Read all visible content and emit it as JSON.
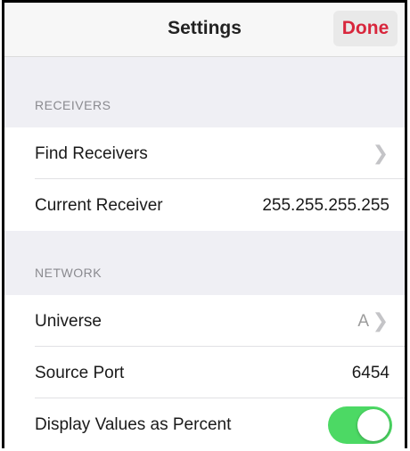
{
  "navbar": {
    "title": "Settings",
    "done_label": "Done"
  },
  "sections": {
    "receivers": {
      "header": "RECEIVERS",
      "find_receivers_label": "Find Receivers",
      "current_receiver_label": "Current Receiver",
      "current_receiver_value": "255.255.255.255"
    },
    "network": {
      "header": "NETWORK",
      "universe_label": "Universe",
      "universe_value": "A",
      "source_port_label": "Source Port",
      "source_port_value": "6454",
      "display_percent_label": "Display Values as Percent",
      "display_percent_on": true
    }
  },
  "colors": {
    "accent": "#d8263c",
    "toggle_on": "#4cd964"
  },
  "icons": {
    "chevron": "chevron-right-icon"
  }
}
